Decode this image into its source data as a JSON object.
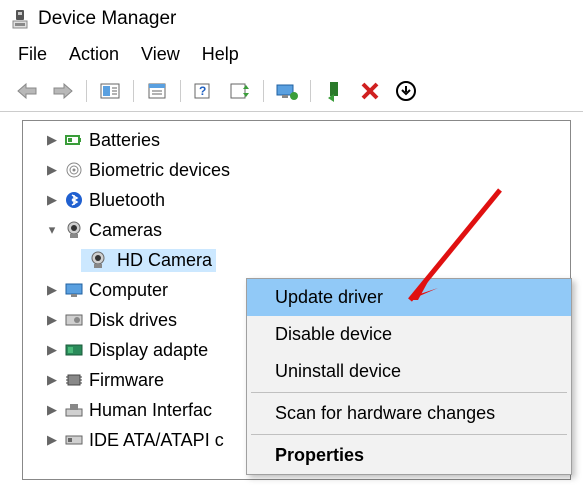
{
  "title": "Device Manager",
  "menubar": {
    "file": "File",
    "action": "Action",
    "view": "View",
    "help": "Help"
  },
  "tree": {
    "batteries": "Batteries",
    "biometric": "Biometric devices",
    "bluetooth": "Bluetooth",
    "cameras": "Cameras",
    "hd_camera": "HD Camera",
    "computer": "Computer",
    "disk_drives": "Disk drives",
    "display_adapters": "Display adapte",
    "firmware": "Firmware",
    "human_interface": "Human Interfac",
    "ide": "IDE ATA/ATAPI c"
  },
  "context_menu": {
    "update": "Update driver",
    "disable": "Disable device",
    "uninstall": "Uninstall device",
    "scan": "Scan for hardware changes",
    "properties": "Properties"
  }
}
